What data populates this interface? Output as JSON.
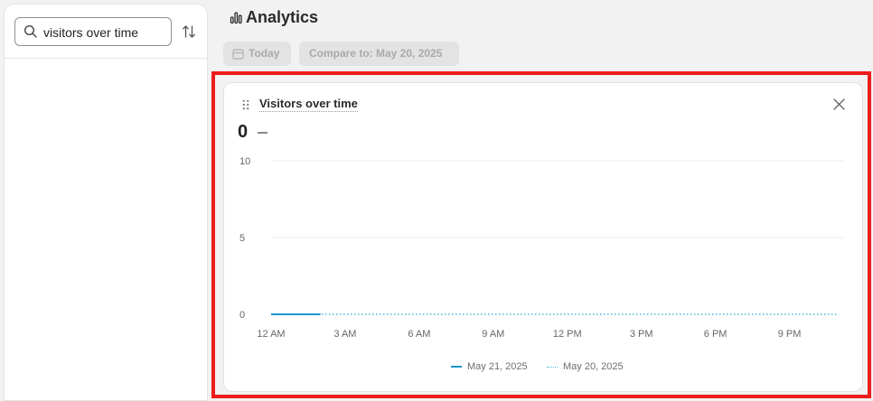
{
  "sidebar": {
    "search": {
      "value": "visitors over time"
    },
    "icons": {
      "search": "search-icon",
      "sort": "sort-arrows-icon"
    }
  },
  "header": {
    "title": "Analytics",
    "icon": "bar-chart-icon",
    "date_chip": "Today",
    "compare_chip": "Compare to: May 20, 2025"
  },
  "card": {
    "title": "Visitors over time",
    "value": "0",
    "delta": "—"
  },
  "colors": {
    "primary_series": "#1c97c9",
    "compare_series": "#4bb6dc",
    "highlight": "#ee1c1c"
  },
  "chart_data": {
    "type": "line",
    "title": "Visitors over time",
    "xlabel": "",
    "ylabel": "",
    "ylim": [
      0,
      10
    ],
    "yticks": [
      "0",
      "5",
      "10"
    ],
    "xticks": [
      "12 AM",
      "3 AM",
      "6 AM",
      "9 AM",
      "12 PM",
      "3 PM",
      "6 PM",
      "9 PM"
    ],
    "grid": true,
    "legend_position": "bottom",
    "series": [
      {
        "name": "May 21, 2025",
        "style": "solid",
        "x_hours": [
          0,
          1,
          2
        ],
        "y": [
          0,
          0,
          0
        ]
      },
      {
        "name": "May 20, 2025",
        "style": "dotted",
        "x_hours": [
          0,
          3,
          6,
          9,
          12,
          15,
          18,
          21,
          23
        ],
        "y": [
          0,
          0,
          0,
          0,
          0,
          0,
          0,
          0,
          0
        ]
      }
    ]
  }
}
